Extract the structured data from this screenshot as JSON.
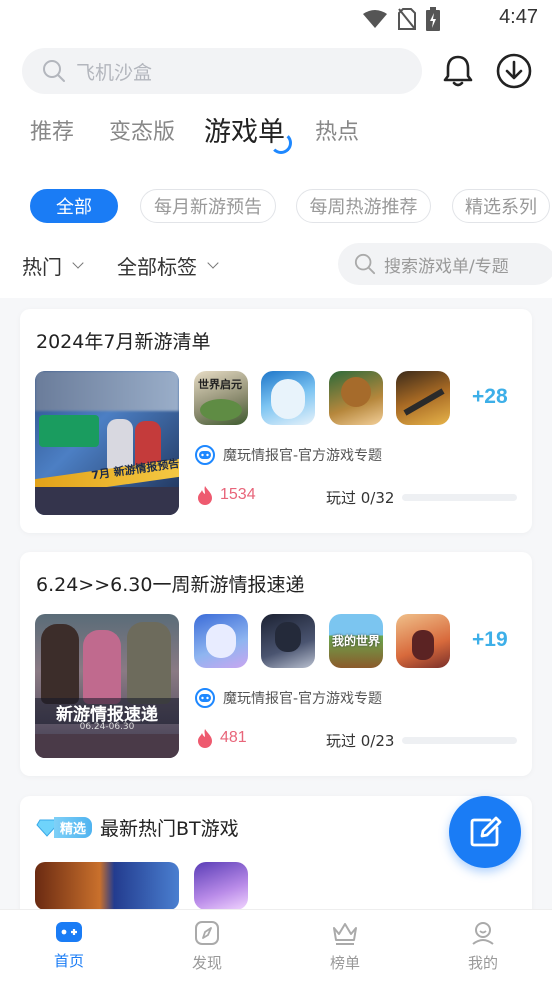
{
  "status_bar": {
    "time": "4:47"
  },
  "search": {
    "placeholder": "飞机沙盒"
  },
  "tabs": [
    {
      "label": "推荐"
    },
    {
      "label": "变态版"
    },
    {
      "label": "游戏单",
      "active": true
    },
    {
      "label": "热点"
    }
  ],
  "chips": [
    {
      "label": "全部",
      "active": true
    },
    {
      "label": "每月新游预告"
    },
    {
      "label": "每周热游推荐"
    },
    {
      "label": "精选系列"
    }
  ],
  "filters": {
    "sort": "热门",
    "tags": "全部标签",
    "search_placeholder": "搜索游戏单/专题"
  },
  "cards": [
    {
      "title": "2024年7月新游清单",
      "more": "+28",
      "author": "魔玩情报官-官方游戏专题",
      "heat": "1534",
      "played": "玩过 0/32",
      "progress": 0,
      "cover_text": "7月 新游情报预告",
      "thumb_texts": [
        "世界启元",
        "",
        "",
        ""
      ]
    },
    {
      "title": "6.24>>6.30一周新游情报速递",
      "more": "+19",
      "author": "魔玩情报官-官方游戏专题",
      "heat": "481",
      "played": "玩过 0/23",
      "progress": 0,
      "cover_text": "新游情报速递",
      "cover_subtext": "06.24-06.30",
      "thumb_texts": [
        "",
        "",
        "我的世界",
        ""
      ]
    },
    {
      "badge": "精选",
      "title": "最新热门BT游戏"
    }
  ],
  "bottom_nav": [
    {
      "label": "首页",
      "active": true
    },
    {
      "label": "发现"
    },
    {
      "label": "榜单"
    },
    {
      "label": "我的"
    }
  ],
  "colors": {
    "accent": "#1a7cf5",
    "heat": "#e8657a",
    "more": "#3dafe8"
  }
}
